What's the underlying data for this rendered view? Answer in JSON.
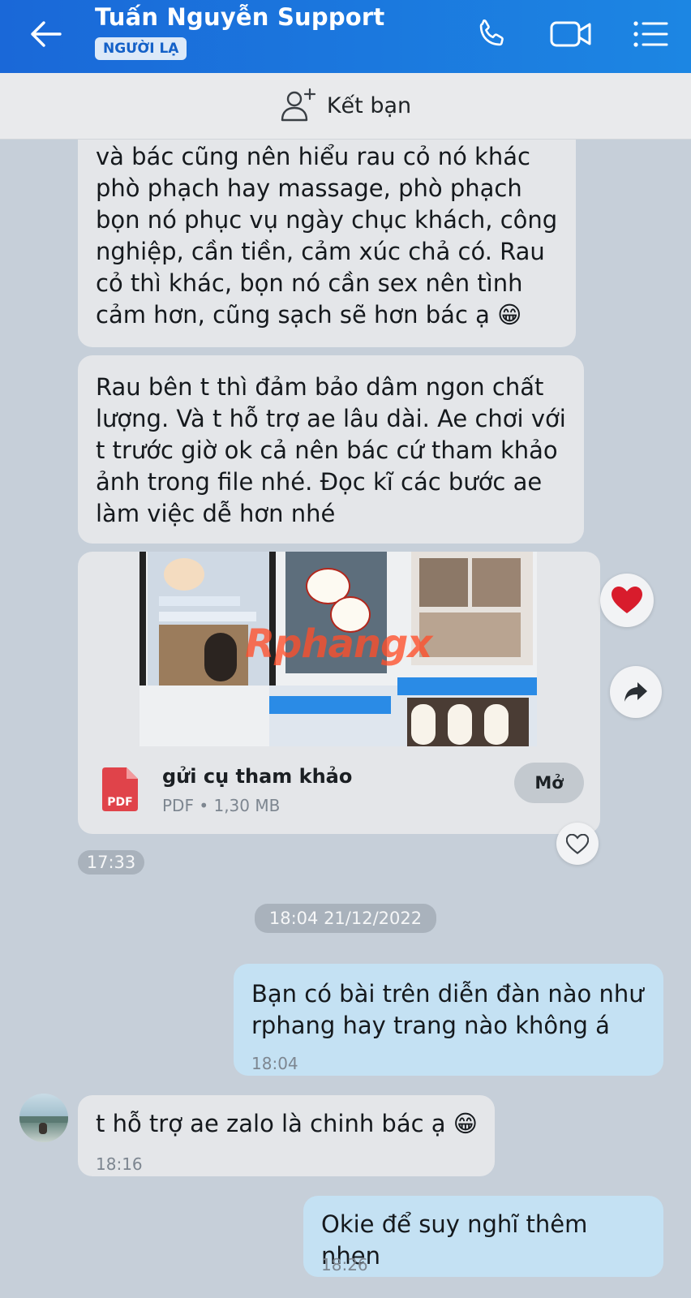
{
  "header": {
    "title": "Tuấn Nguyễn Support",
    "badge": "NGƯỜI LẠ",
    "icons": [
      "back-arrow-icon",
      "phone-icon",
      "video-call-icon",
      "menu-list-icon"
    ]
  },
  "friend_bar": {
    "label": "Kết bạn",
    "icon": "add-friend-icon"
  },
  "messages": [
    {
      "direction": "in",
      "text_lines": [
        "và bác cũng nên hiểu rau cỏ nó khác",
        "phò phạch hay massage, phò phạch",
        "bọn nó phục vụ ngày chục khách, công",
        "nghiệp, cần tiền, cảm xúc chả có. Rau",
        "cỏ thì khác, bọn nó cần sex nên tình",
        "cảm hơn, cũng sạch sẽ hơn bác ạ 😁"
      ]
    },
    {
      "direction": "in",
      "text_lines": [
        "Rau bên t thì đảm bảo dâm ngon chất",
        "lượng. Và t hỗ trợ ae lâu dài. Ae chơi với",
        "t trước giờ ok cả nên bác cứ tham khảo",
        "ảnh trong file nhé. Đọc kĩ các bước ae",
        "làm việc dễ hơn nhé"
      ]
    },
    {
      "direction": "in",
      "type": "file",
      "watermark": "Rphangx",
      "file_name": "gửi cụ tham khảo",
      "file_meta": "PDF • 1,30 MB",
      "file_icon_label": "PDF",
      "open_label": "Mở",
      "time": "17:33",
      "reaction": "heart"
    },
    {
      "direction": "out",
      "text_lines": [
        "Bạn có bài trên diễn đàn nào như",
        "rphang hay trang nào không á"
      ],
      "time": "18:04"
    },
    {
      "direction": "in",
      "text_lines": [
        "t hỗ trợ ae zalo là chinh bác ạ 😁"
      ],
      "time": "18:16"
    },
    {
      "direction": "out",
      "text_lines": [
        "Okie để suy nghĩ thêm nhen"
      ],
      "time": "18:26"
    }
  ],
  "date_separator": "18:04 21/12/2022",
  "colors": {
    "header": "#1a68d8",
    "incoming_bubble": "#e4e6e9",
    "outgoing_bubble": "#c4e1f3",
    "background": "#c6cfd9",
    "reaction_heart": "#d81c2c",
    "pdf_icon": "#e0434a"
  }
}
